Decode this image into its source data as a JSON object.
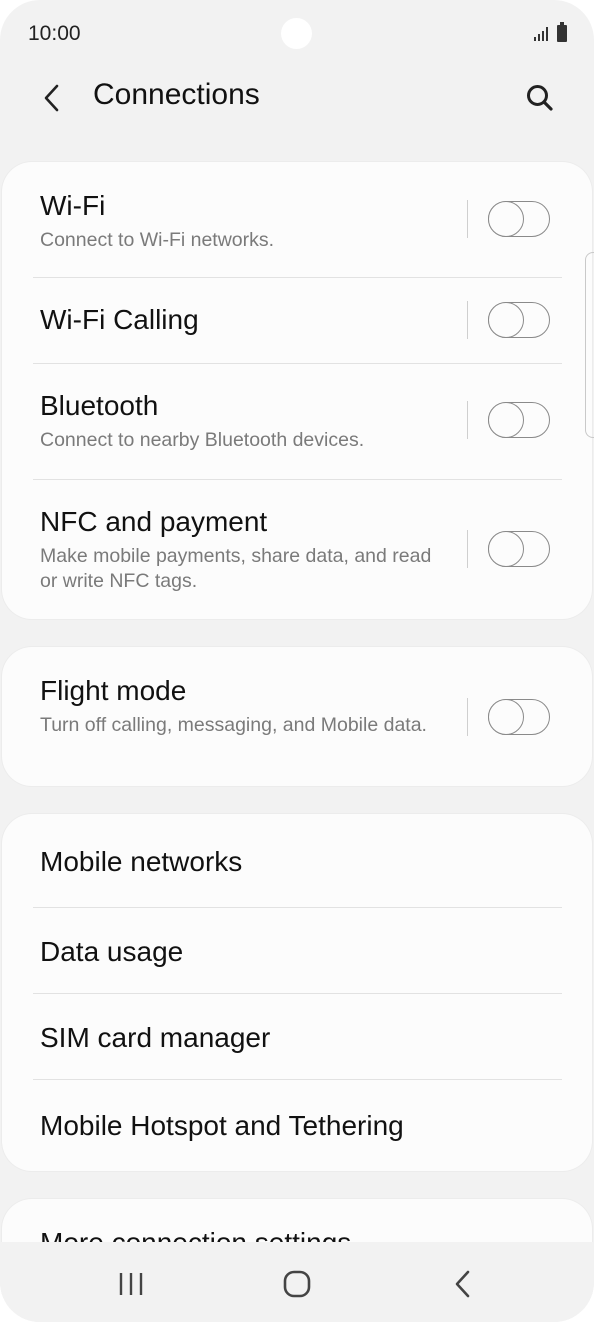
{
  "status_bar": {
    "time": "10:00",
    "icons": [
      "signal-icon",
      "battery-icon"
    ]
  },
  "header": {
    "title": "Connections",
    "back_icon": "chevron-left-icon",
    "search_icon": "search-icon"
  },
  "sections": [
    {
      "items": [
        {
          "title": "Wi-Fi",
          "subtitle": "Connect to Wi-Fi networks.",
          "toggle": "off"
        },
        {
          "title": "Wi-Fi Calling",
          "toggle": "off"
        },
        {
          "title": "Bluetooth",
          "subtitle": "Connect to nearby Bluetooth devices.",
          "toggle": "off"
        },
        {
          "title": "NFC and payment",
          "subtitle": "Make mobile payments, share data, and read or write NFC tags.",
          "toggle": "off"
        }
      ]
    },
    {
      "items": [
        {
          "title": "Flight mode",
          "subtitle": "Turn off calling, messaging, and Mobile data.",
          "toggle": "off"
        }
      ]
    },
    {
      "items": [
        {
          "title": "Mobile networks"
        },
        {
          "title": "Data usage"
        },
        {
          "title": "SIM card manager"
        },
        {
          "title": "Mobile Hotspot and Tethering"
        }
      ]
    },
    {
      "items": [
        {
          "title": "More connection settings"
        }
      ]
    }
  ],
  "nav_bar": {
    "icons": [
      "recents-icon",
      "home-icon",
      "back-icon"
    ]
  },
  "colors": {
    "background": "#f2f2f2",
    "card": "#fcfcfc",
    "toggle_off": "#8a8a8a",
    "subtitle": "#7a7a7a"
  }
}
